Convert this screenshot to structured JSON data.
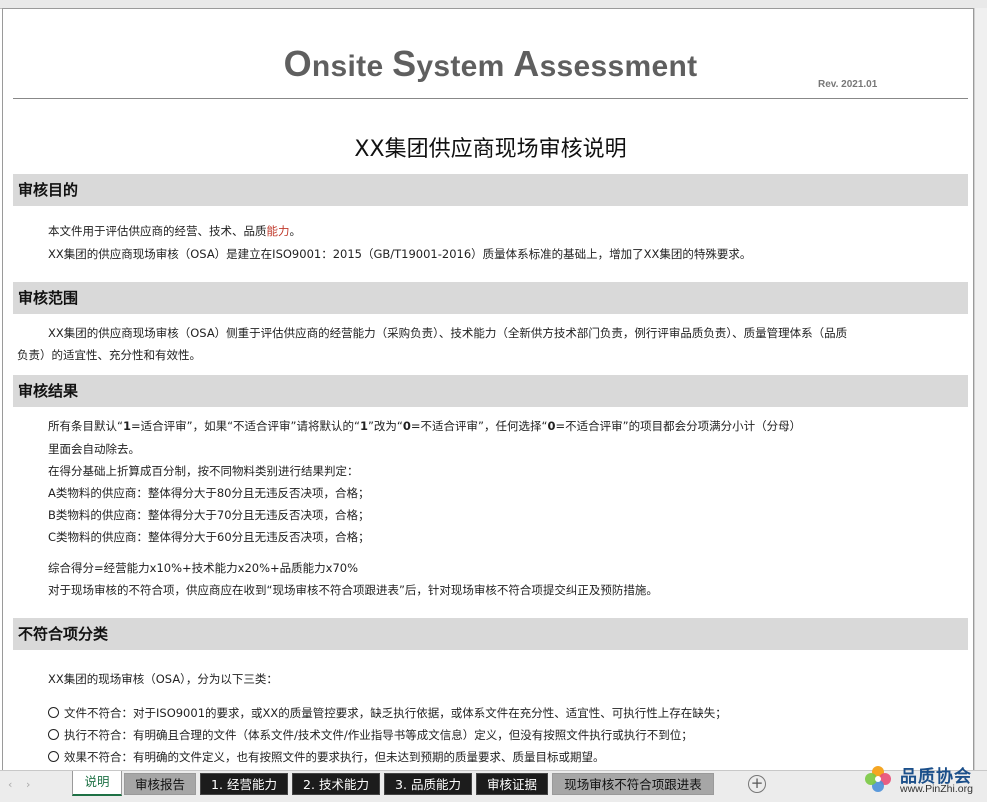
{
  "header": {
    "title_o": "O",
    "title_1": "nsite ",
    "title_s": "S",
    "title_2": "ystem ",
    "title_a": "A",
    "title_3": "ssessment",
    "revision": "Rev. 2021.01",
    "doc_title": "XX集团供应商现场审核说明"
  },
  "sections": {
    "purpose": {
      "heading": "审核目的",
      "line1_a": "本文件用于评估供应商的经营、技术、品质",
      "line1_red": "能力",
      "line1_b": "。",
      "line2": "XX集团的供应商现场审核（OSA）是建立在ISO9001：2015（GB/T19001-2016）质量体系标准的基础上，增加了XX集团的特殊要求。"
    },
    "scope": {
      "heading": "审核范围",
      "line1": "XX集团的供应商现场审核（OSA）侧重于评估供应商的经营能力（采购负责）、技术能力（全新供方技术部门负责，例行评审品质负责）、质量管理体系（品质",
      "line2": "负责）的适宜性、充分性和有效性。"
    },
    "result": {
      "heading": "审核结果",
      "l1_a": "所有条目默认“",
      "l1_b": "1",
      "l1_c": "=适合评审”，如果“不适合评审”请将默认的“",
      "l1_d": "1",
      "l1_e": "”改为“",
      "l1_f": "0",
      "l1_g": "=不适合评审”，任何选择“",
      "l1_h": "0",
      "l1_i": "=不适合评审”的项目都会分项满分小计（分母）",
      "line2": "里面会自动除去。",
      "line3": "在得分基础上折算成百分制，按不同物料类别进行结果判定：",
      "line4": "A类物料的供应商：整体得分大于80分且无违反否决项，合格；",
      "line5": "B类物料的供应商：整体得分大于70分且无违反否决项，合格；",
      "line6": "C类物料的供应商：整体得分大于60分且无违反否决项，合格；",
      "line7": "综合得分=经营能力x10%+技术能力x20%+品质能力x70%",
      "line8": "对于现场审核的不符合项，供应商应在收到“现场审核不符合项跟进表”后，针对现场审核不符合项提交纠正及预防措施。"
    },
    "nonconform": {
      "heading": "不符合项分类",
      "intro": "XX集团的现场审核（OSA），分为以下三类：",
      "items": [
        "文件不符合：对于ISO9001的要求，或XX的质量管控要求，缺乏执行依据，或体系文件在充分性、适宜性、可执行性上存在缺失；",
        "执行不符合：有明确且合理的文件（体系文件/技术文件/作业指导书等成文信息）定义，但没有按照文件执行或执行不到位；",
        "效果不符合：有明确的文件定义，也有按照文件的要求执行，但未达到预期的质量要求、质量目标或期望。"
      ]
    }
  },
  "tabs": [
    {
      "label": "说明",
      "style": "active"
    },
    {
      "label": "审核报告",
      "style": "grey"
    },
    {
      "label": "1. 经营能力",
      "style": "black"
    },
    {
      "label": "2. 技术能力",
      "style": "black"
    },
    {
      "label": "3. 品质能力",
      "style": "black"
    },
    {
      "label": "审核证据",
      "style": "black"
    },
    {
      "label": "现场审核不符合项跟进表",
      "style": "grey"
    }
  ],
  "tabbar": {
    "prev_icon": "‹",
    "next_icon": "›",
    "add_icon": "+"
  },
  "logo": {
    "title": "品质协会",
    "url": "www.PinZhi.org"
  },
  "colors": {
    "section_bg": "#d9d9d9",
    "accent_red": "#c0392b",
    "active_tab": "#1e7145",
    "logo_blue": "#1b4f8a"
  }
}
